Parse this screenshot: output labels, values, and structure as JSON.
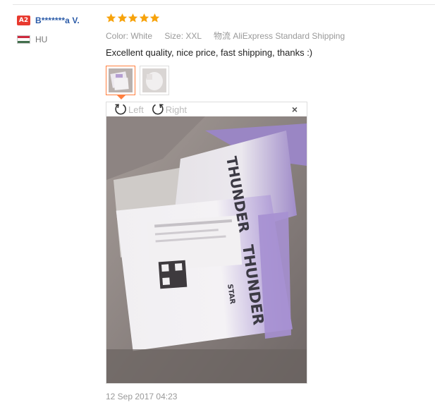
{
  "user": {
    "level_badge": "A2",
    "name": "B*******a V.",
    "country_code": "HU",
    "flag_colors": [
      "#cd2a3e",
      "#ffffff",
      "#436f4d"
    ]
  },
  "review": {
    "rating": 5,
    "star_color": "#f7a30c",
    "attributes": [
      {
        "label": "Color:",
        "value": "White"
      },
      {
        "label": "Size:",
        "value": "XXL"
      },
      {
        "label": "物流",
        "value": "AliExpress Standard Shipping"
      }
    ],
    "text": "Excellent quality, nice price, fast shipping, thanks :)",
    "date": "12 Sep 2017 04:23"
  },
  "viewer": {
    "rotate_left_label": "Left",
    "rotate_right_label": "Right",
    "rotate_left_icon": "rotate-left-icon",
    "rotate_right_icon": "rotate-right-icon",
    "close_glyph": "×",
    "active_border_color": "#ff7f3f",
    "photo_brand_text": "THUNDER",
    "photo_brand_text_2": "THUNDER",
    "photo_brand_sub": "STAR"
  }
}
